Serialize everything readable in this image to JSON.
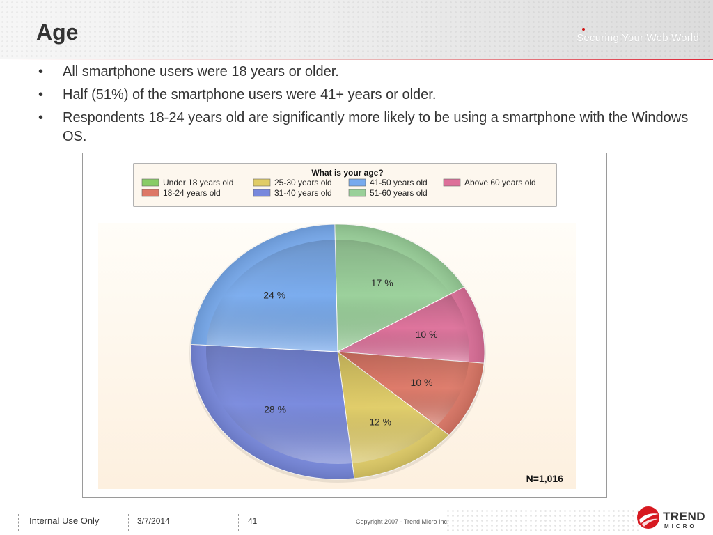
{
  "slide": {
    "title": "Age",
    "tagline": "Securing Your Web World",
    "bullets": [
      "All smartphone users were 18 years or older.",
      "Half (51%) of the smartphone users were 41+ years or older.",
      "Respondents 18-24 years old are significantly more likely to be using a smartphone with the Windows OS."
    ],
    "bullet_symbol": "•"
  },
  "chart_data": {
    "type": "pie",
    "title": "What is your age?",
    "legend_position": "top",
    "categories": [
      "Under 18 years old",
      "18-24 years old",
      "25-30 years old",
      "31-40 years old",
      "41-50 years old",
      "51-60 years old",
      "Above 60 years old"
    ],
    "values": [
      0,
      10,
      12,
      28,
      24,
      17,
      10
    ],
    "value_labels": [
      "",
      "10 %",
      "12 %",
      "28 %",
      "24 %",
      "17 %",
      "10 %"
    ],
    "colors": [
      "#88cc66",
      "#dd7766",
      "#e0cc66",
      "#7788dd",
      "#77aaee",
      "#99d099",
      "#dd6f99"
    ],
    "annotation": "N=1,016"
  },
  "footer": {
    "label": "Internal Use Only",
    "date": "3/7/2014",
    "page": "41",
    "copyright": "Copyright 2007 - Trend Micro Inc.",
    "logo_line1": "TREND",
    "logo_line2": "MICRO"
  }
}
